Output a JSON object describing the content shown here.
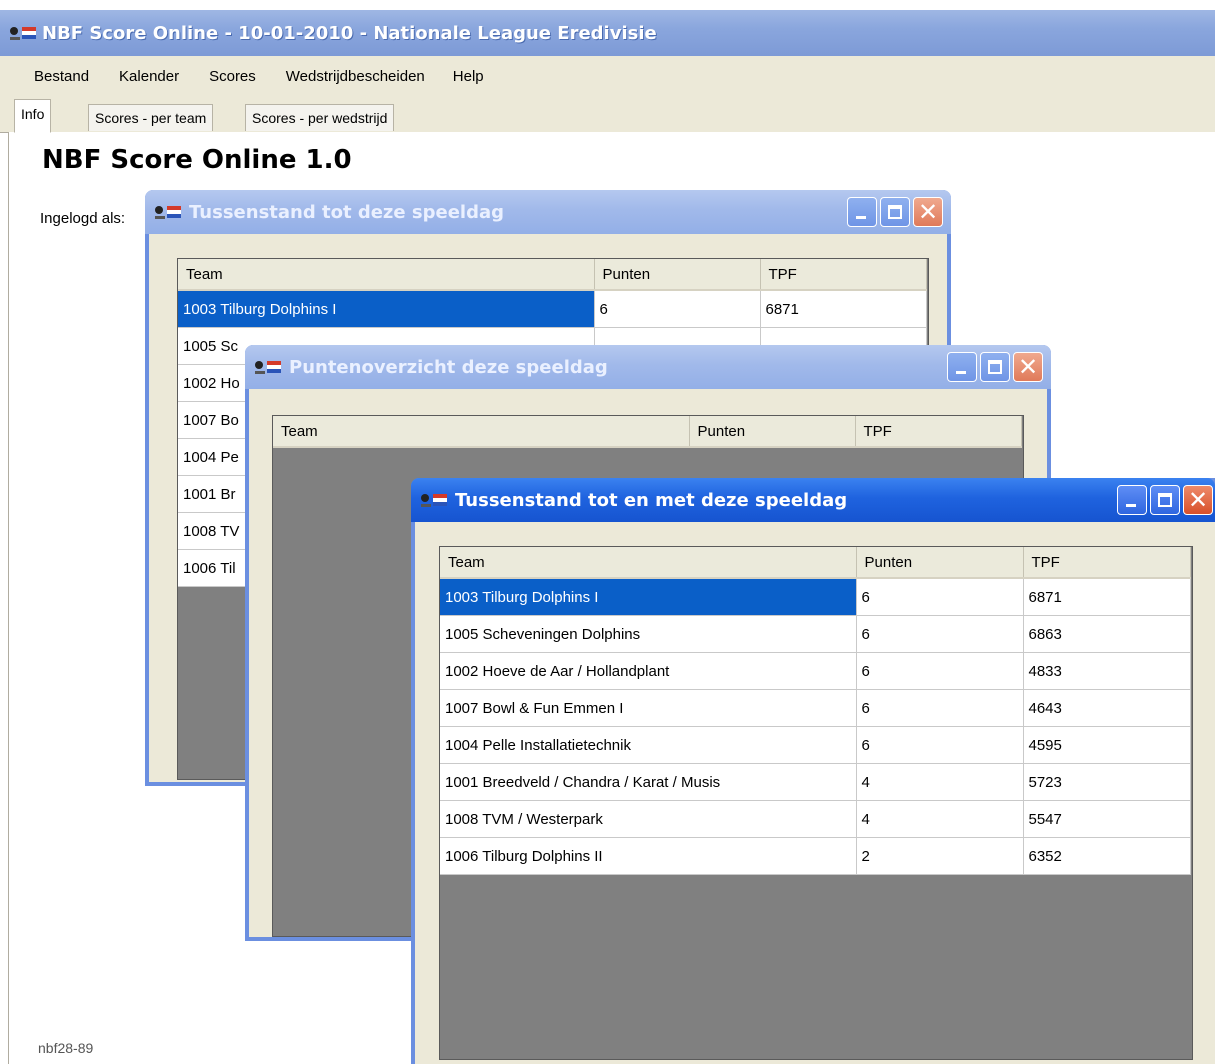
{
  "window": {
    "title": "NBF Score Online - 10-01-2010 - Nationale League Eredivisie"
  },
  "menu": [
    "Bestand",
    "Kalender",
    "Scores",
    "Wedstrijdbescheiden",
    "Help"
  ],
  "tabs": [
    "Info",
    "Scores - per team",
    "Scores - per wedstrijd"
  ],
  "content": {
    "heading": "NBF Score Online 1.0",
    "login_label": "Ingelogd als:",
    "footer_code": "nbf28-89"
  },
  "columns": [
    "Team",
    "Punten",
    "TPF"
  ],
  "windows": [
    {
      "title": "Tussenstand tot deze speeldag",
      "rows": [
        {
          "team": "1003 Tilburg Dolphins I",
          "punten": "6",
          "tpf": "6871"
        },
        {
          "team": "1005 Sc",
          "punten": "",
          "tpf": ""
        },
        {
          "team": "1002 Ho",
          "punten": "",
          "tpf": ""
        },
        {
          "team": "1007 Bo",
          "punten": "",
          "tpf": ""
        },
        {
          "team": "1004 Pe",
          "punten": "",
          "tpf": ""
        },
        {
          "team": "1001 Br",
          "punten": "",
          "tpf": ""
        },
        {
          "team": "1008 TV",
          "punten": "",
          "tpf": ""
        },
        {
          "team": "1006 Til",
          "punten": "",
          "tpf": ""
        }
      ]
    },
    {
      "title": "Puntenoverzicht deze speeldag",
      "rows": []
    },
    {
      "title": "Tussenstand tot en met deze speeldag",
      "rows": [
        {
          "team": "1003 Tilburg Dolphins I",
          "punten": "6",
          "tpf": "6871"
        },
        {
          "team": "1005 Scheveningen Dolphins",
          "punten": "6",
          "tpf": "6863"
        },
        {
          "team": "1002 Hoeve de Aar / Hollandplant",
          "punten": "6",
          "tpf": "4833"
        },
        {
          "team": "1007 Bowl & Fun Emmen I",
          "punten": "6",
          "tpf": "4643"
        },
        {
          "team": "1004 Pelle Installatietechnik",
          "punten": "6",
          "tpf": "4595"
        },
        {
          "team": "1001 Breedveld / Chandra / Karat / Musis",
          "punten": "4",
          "tpf": "5723"
        },
        {
          "team": "1008 TVM / Westerpark",
          "punten": "4",
          "tpf": "5547"
        },
        {
          "team": "1006 Tilburg Dolphins II",
          "punten": "2",
          "tpf": "6352"
        }
      ]
    }
  ],
  "colors": {
    "selection": "#0a5fc8",
    "active_titlebar": "#1f63df",
    "inactive_titlebar": "#a1b9ea",
    "grid_empty": "#808080"
  }
}
